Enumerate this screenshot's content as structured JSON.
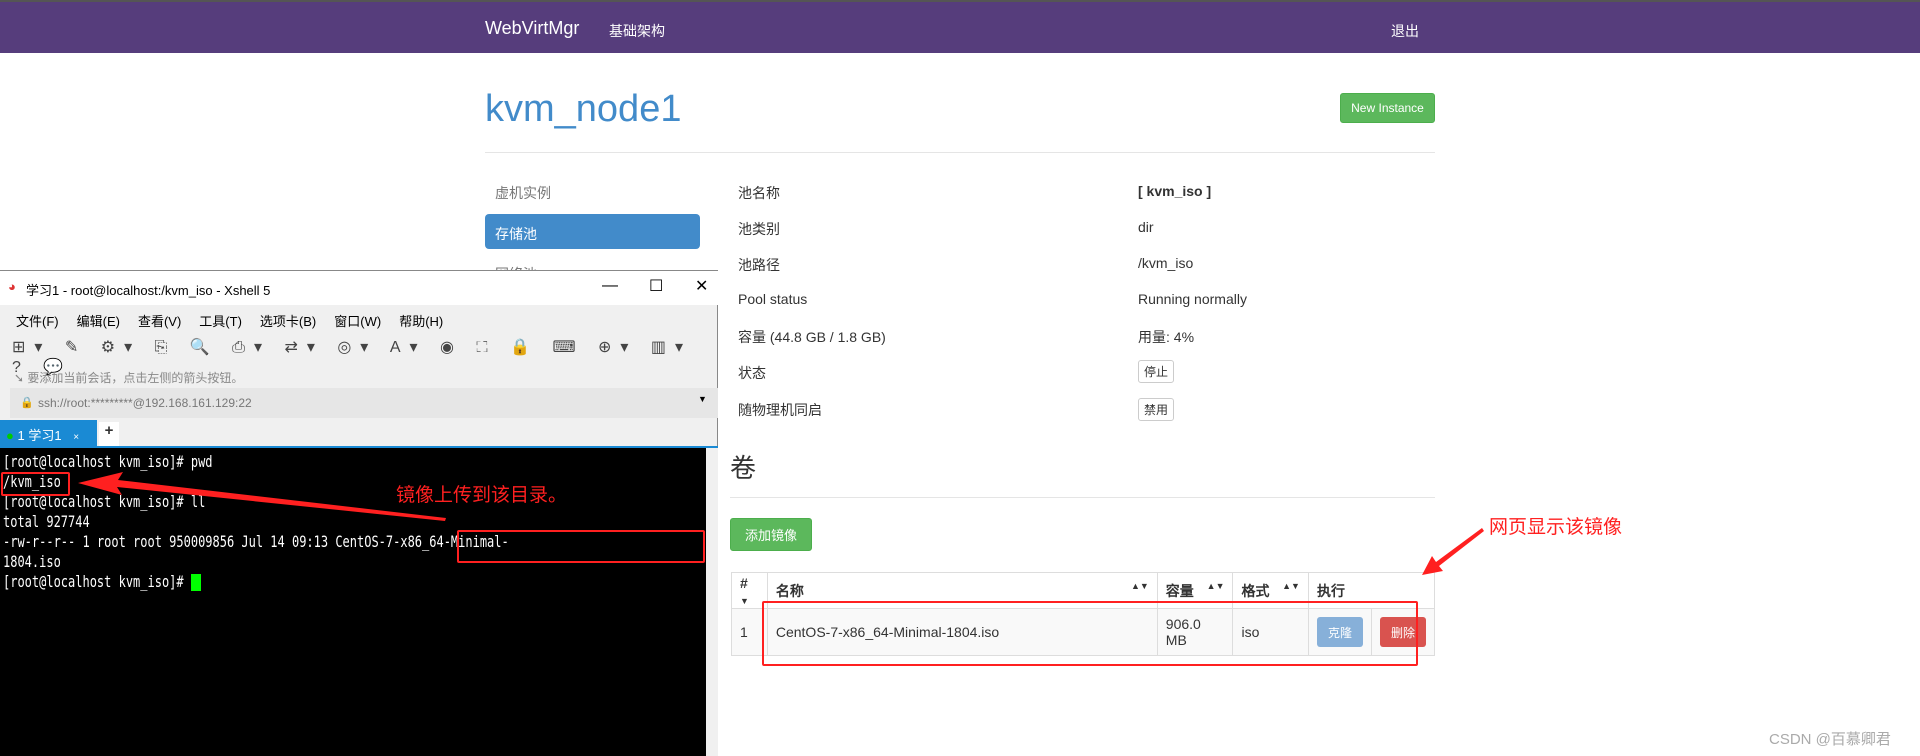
{
  "nav": {
    "brand": "WebVirtMgr",
    "infrastructure": "基础架构",
    "logout": "退出"
  },
  "page_title": "kvm_node1",
  "new_instance": "New Instance",
  "sidebar": {
    "items": [
      "虚机实例",
      "存储池",
      "网络池"
    ],
    "active": "存储池"
  },
  "pool": {
    "rows": [
      {
        "label": "池名称",
        "value": "[ kvm_iso ]"
      },
      {
        "label": "池类别",
        "value": "dir"
      },
      {
        "label": "池路径",
        "value": "/kvm_iso"
      },
      {
        "label": "Pool status",
        "value": "Running normally"
      },
      {
        "label": "容量 (44.8 GB / 1.8 GB)",
        "value": "用量: 4%"
      },
      {
        "label": "状态",
        "value": "停止"
      },
      {
        "label": "随物理机同启",
        "value": "禁用"
      }
    ]
  },
  "volumes": {
    "heading": "卷",
    "add_button": "添加镜像",
    "columns": [
      "#",
      "名称",
      "容量",
      "格式",
      "执行"
    ],
    "rows": [
      {
        "num": "1",
        "name": "CentOS-7-x86_64-Minimal-1804.iso",
        "size": "906.0 MB",
        "format": "iso",
        "clone": "克隆",
        "delete": "删除"
      }
    ]
  },
  "xshell": {
    "title": "学习1 - root@localhost:/kvm_iso - Xshell 5",
    "menu": [
      "文件(F)",
      "编辑(E)",
      "查看(V)",
      "工具(T)",
      "选项卡(B)",
      "窗口(W)",
      "帮助(H)"
    ],
    "hint": "要添加当前会话，点击左侧的箭头按钮。",
    "address": "ssh://root:*********@192.168.161.129:22",
    "tab": "1 学习1",
    "terminal": [
      "[root@localhost kvm_iso]# pwd",
      "/kvm_iso",
      "[root@localhost kvm_iso]# ll",
      "total 927744",
      "-rw-r--r-- 1 root root 950009856 Jul 14 09:13 CentOS-7-x86_64-Minimal-",
      "1804.iso",
      "[root@localhost kvm_iso]# "
    ]
  },
  "annotations": {
    "upload_note": "镜像上传到该目录。",
    "web_note": "网页显示该镜像"
  },
  "watermark": "CSDN @百慕卿君",
  "colors": {
    "nav": "#563d7c",
    "primary": "#428bca",
    "success": "#5cb85c",
    "danger": "#d9534f",
    "annotation": "#ff2020"
  }
}
